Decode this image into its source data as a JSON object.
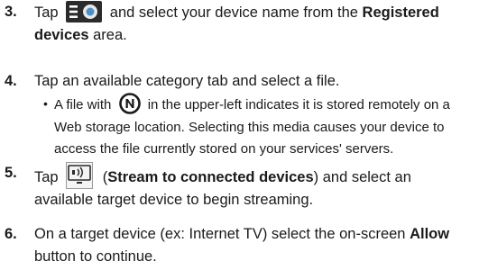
{
  "steps": [
    {
      "number": "3.",
      "part1": "Tap",
      "part2": " and select your device name from the ",
      "bold1": "Registered devices",
      "part3": " area.",
      "icon": "menu-toggle-icon"
    },
    {
      "number": "4.",
      "text": "Tap an available category tab and select a file."
    },
    {
      "bullet": "•",
      "part1": "A file with",
      "part2": " in the upper-left indicates it is stored remotely on a Web storage location. Selecting this media causes your device to access the file currently stored on your services' servers.",
      "icon": "n-circle-icon"
    },
    {
      "number": "5.",
      "part1": "Tap",
      "bold1": "Stream to connected devices",
      "part2": " (",
      "part3": ") and select an available target device to begin streaming.",
      "icon": "stream-icon"
    },
    {
      "number": "6.",
      "part1": "On a target device (ex: Internet TV) select the on-screen ",
      "bold1": "Allow",
      "part2": " button to continue."
    }
  ],
  "colors": {
    "text": "#1a1a1a",
    "icon_dark": "#2b2b2b",
    "icon_accent": "#4a90c8"
  }
}
